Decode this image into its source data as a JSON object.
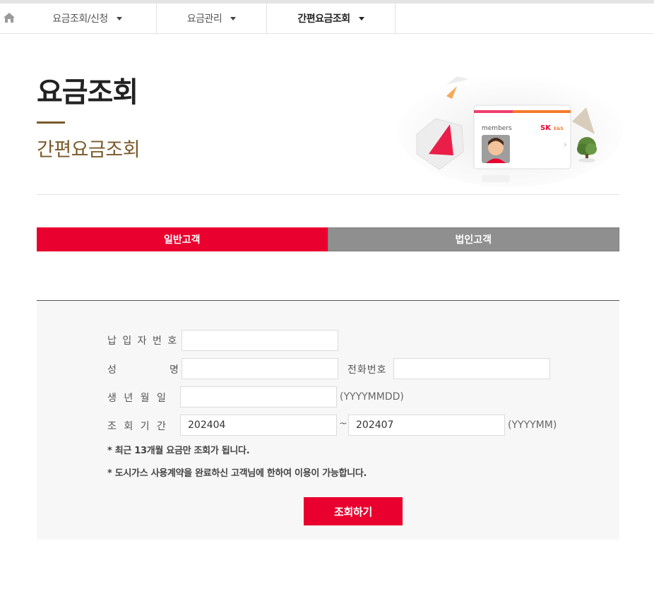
{
  "nav": {
    "items": [
      {
        "label": "요금조회/신청"
      },
      {
        "label": "요금관리"
      },
      {
        "label": "간편요금조회"
      }
    ]
  },
  "header": {
    "title": "요금조회",
    "subtitle": "간편요금조회",
    "card_label": "members",
    "brand_sk": "SK",
    "brand_es": "E&S"
  },
  "tabs": [
    {
      "label": "일반고객"
    },
    {
      "label": "법인고객"
    }
  ],
  "form": {
    "payer_label": "납 입 자 번 호",
    "name_label_1": "성",
    "name_label_2": "명",
    "phone_label": "전화번호",
    "birth_label": "생 년 월 일",
    "birth_hint": "(YYYYMMDD)",
    "period_label": "조 회 기 간",
    "period_from": "202404",
    "period_sep": "~",
    "period_to": "202407",
    "period_hint": "(YYYYMM)",
    "note1": "* 최근 13개월 요금만 조회가 됩니다.",
    "note2": "* 도시가스 사용계약을 완료하신 고객님에 한하여 이용이 가능합니다.",
    "submit_label": "조회하기"
  },
  "colors": {
    "accent": "#e9002e",
    "brown": "#7a5a2a",
    "tab_inactive": "#8f8f8f"
  }
}
